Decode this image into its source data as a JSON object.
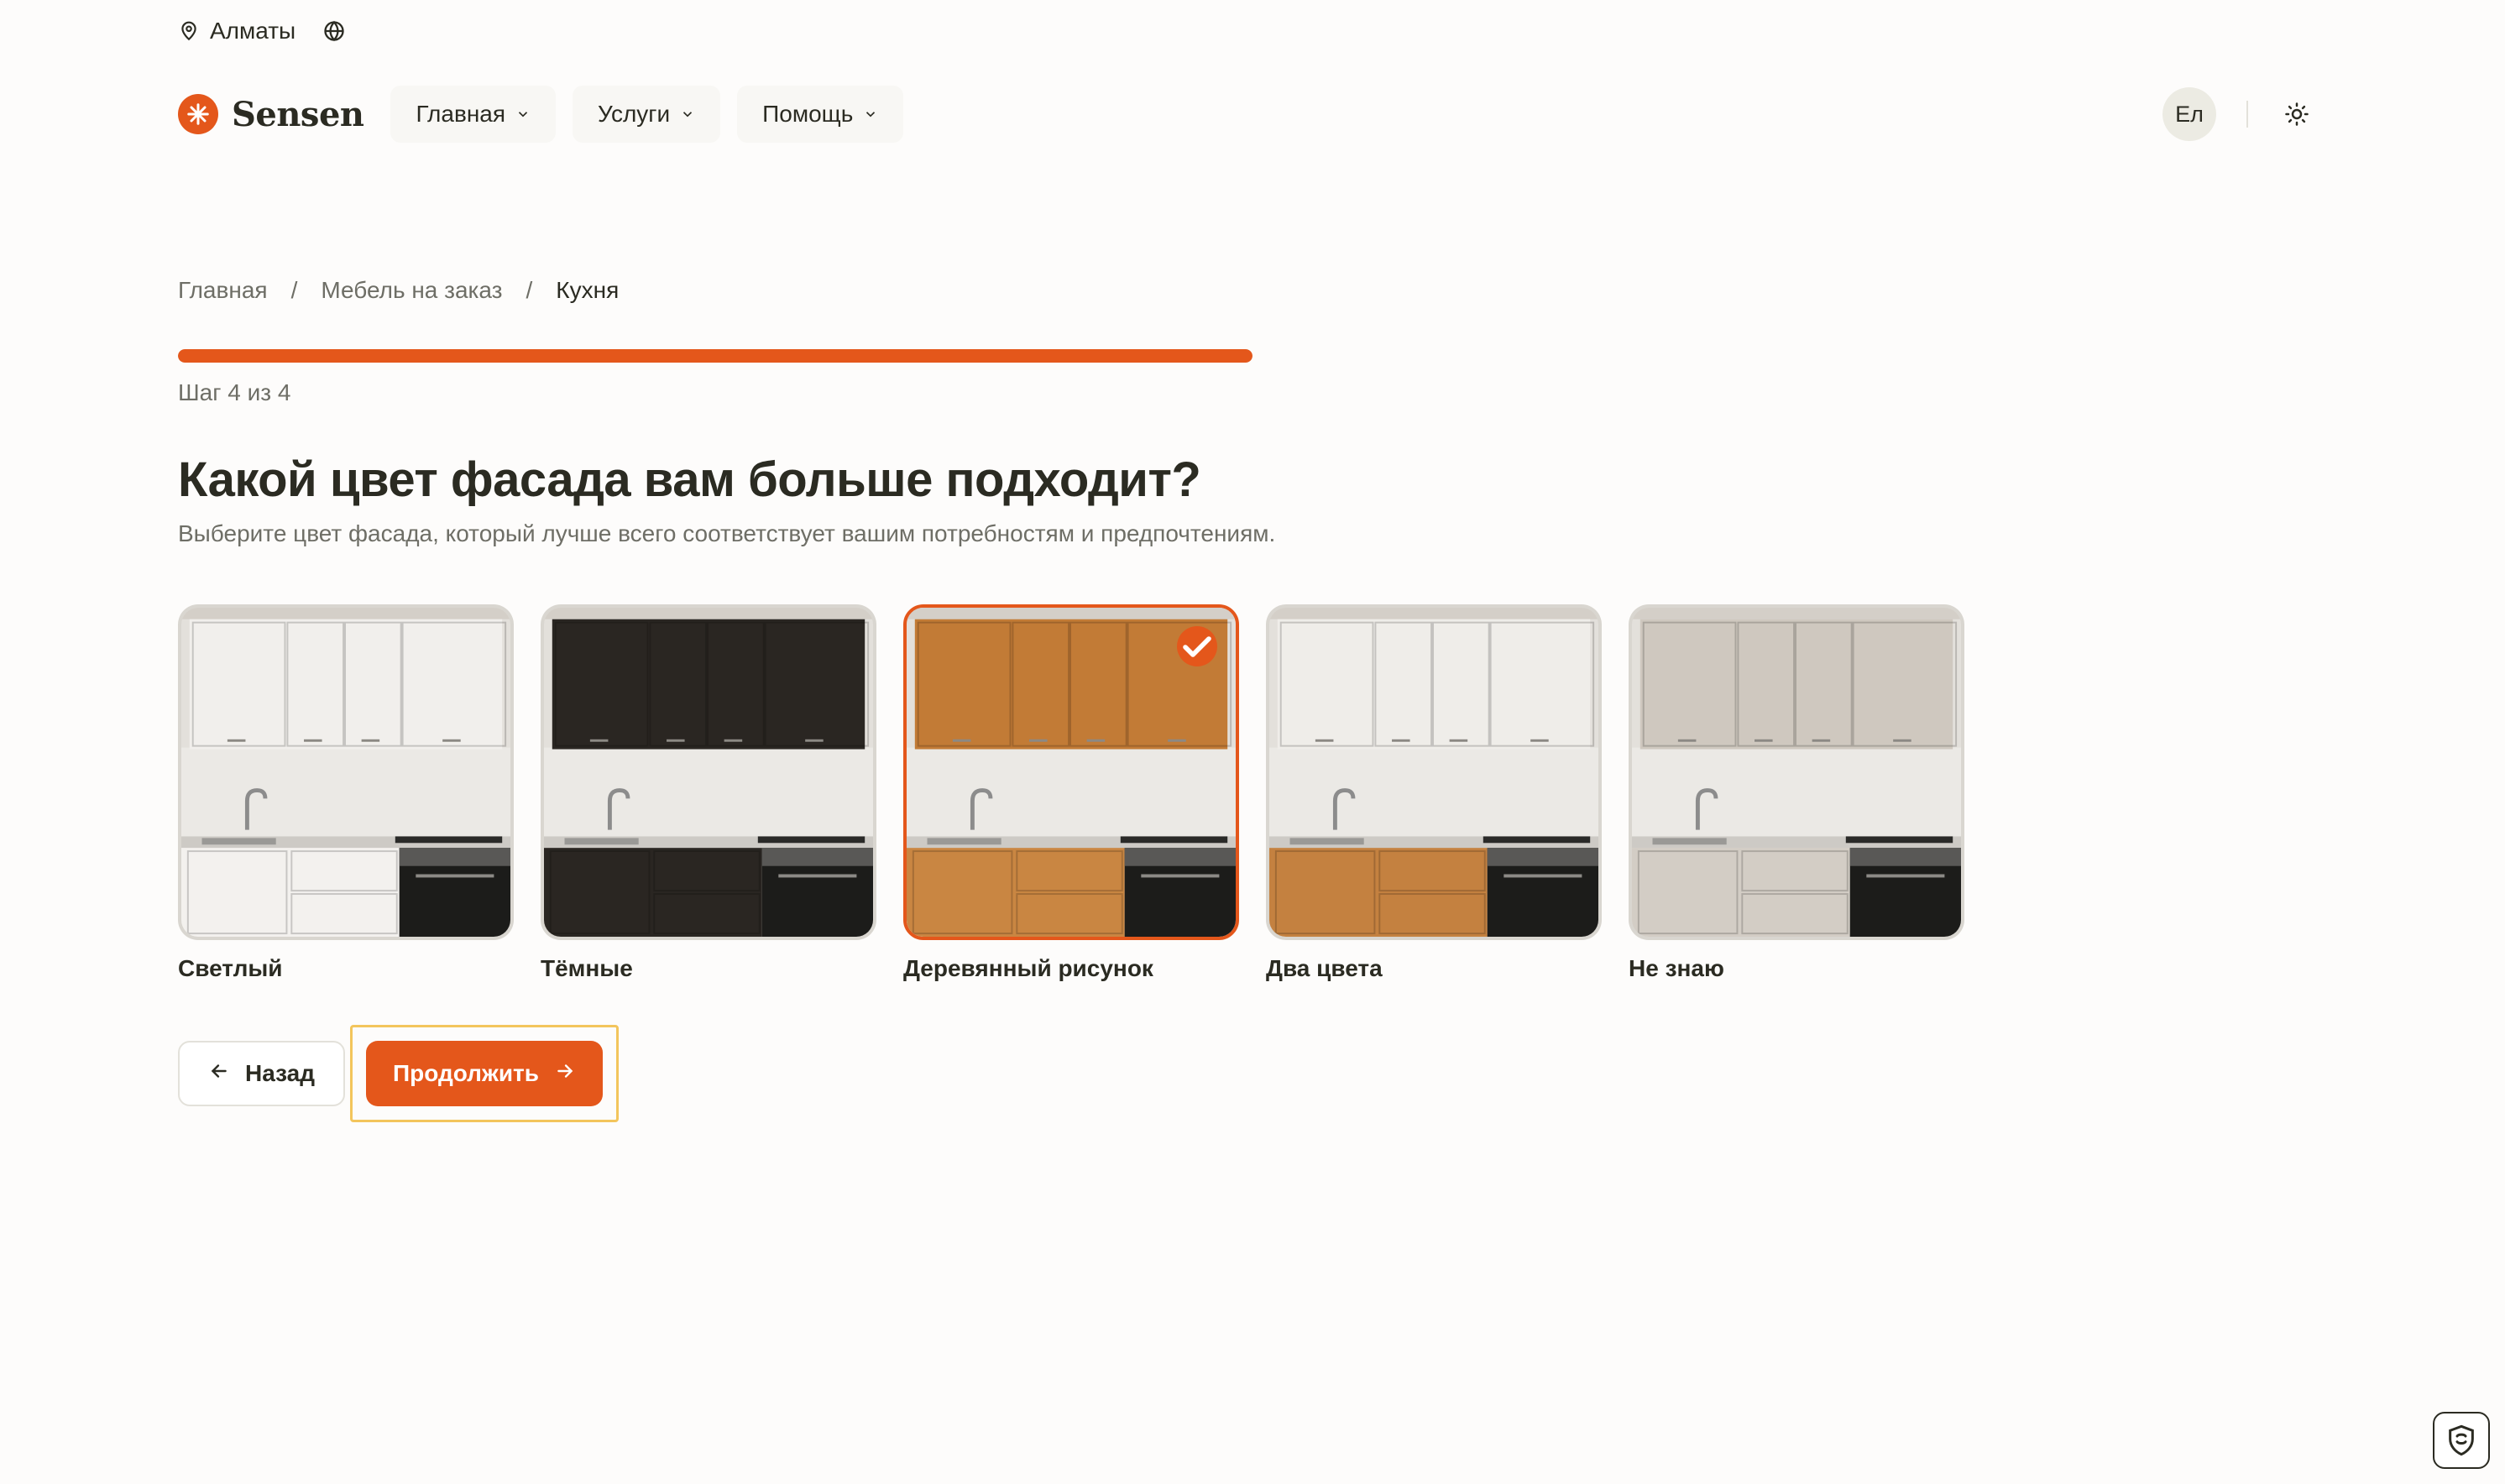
{
  "topbar": {
    "city": "Алматы",
    "location_icon": "map-pin-icon",
    "language_icon": "globe-icon"
  },
  "header": {
    "logo_text": "Sensen",
    "nav": [
      {
        "label": "Главная"
      },
      {
        "label": "Услуги"
      },
      {
        "label": "Помощь"
      }
    ],
    "avatar_initials": "Ел",
    "theme_icon": "sun-icon"
  },
  "breadcrumb": [
    "Главная",
    "Мебель на заказ",
    "Кухня"
  ],
  "progress": {
    "current": 4,
    "total": 4,
    "fraction": 1.0,
    "label": "Шаг 4 из 4"
  },
  "question": {
    "title": "Какой цвет фасада вам больше подходит?",
    "subtitle": "Выберите цвет фасада, который лучше всего соответствует вашим потребностям и предпочтениям."
  },
  "options": [
    {
      "label": "Светлый",
      "selected": false,
      "upper": "#f1efec",
      "lower": "#f3f1ee",
      "appliance": "#1c1c1a"
    },
    {
      "label": "Тёмные",
      "selected": false,
      "upper": "#2a2622",
      "lower": "#2a2622",
      "appliance": "#1c1c1a"
    },
    {
      "label": "Деревянный рисунок",
      "selected": true,
      "upper": "#c27b36",
      "lower": "#c98642",
      "appliance": "#1c1c1a"
    },
    {
      "label": "Два цвета",
      "selected": false,
      "upper": "#efede9",
      "lower": "#c48140",
      "appliance": "#1c1c1a"
    },
    {
      "label": "Не знаю",
      "selected": false,
      "upper": "#cfc8bf",
      "lower": "#d3cdc5",
      "appliance": "#1c1c1a"
    }
  ],
  "actions": {
    "back_label": "Назад",
    "next_label": "Продолжить"
  },
  "colors": {
    "accent": "#e4571b",
    "text": "#2b2b22",
    "muted": "#6e6e66",
    "focus_ring": "#f3c55c"
  }
}
